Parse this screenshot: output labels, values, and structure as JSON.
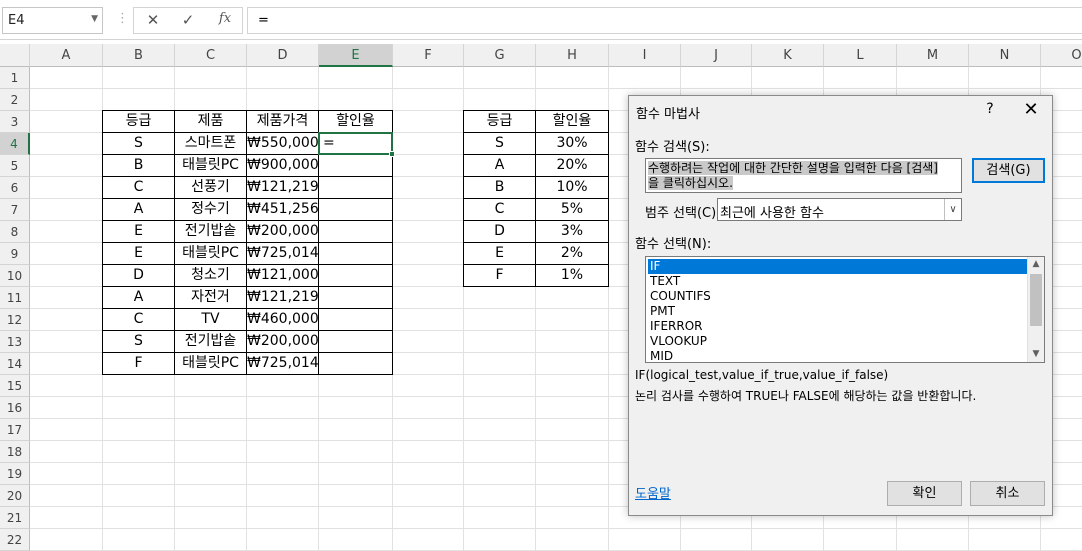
{
  "formula_bar": {
    "name_box": "E4",
    "cancel_icon": "✕",
    "enter_icon": "✓",
    "fx_icon": "fx",
    "formula": "="
  },
  "columns": [
    "A",
    "B",
    "C",
    "D",
    "E",
    "F",
    "G",
    "H",
    "I",
    "J",
    "K",
    "L",
    "M",
    "N",
    "O"
  ],
  "rows": [
    "1",
    "2",
    "3",
    "4",
    "5",
    "6",
    "7",
    "8",
    "9",
    "10",
    "11",
    "12",
    "13",
    "14",
    "15",
    "16",
    "17",
    "18",
    "19",
    "20",
    "21",
    "22"
  ],
  "table1": {
    "headers": [
      "등급",
      "제품",
      "제품가격",
      "할인율"
    ],
    "rows": [
      [
        "S",
        "스마트폰",
        "₩550,000",
        "="
      ],
      [
        "B",
        "태블릿PC",
        "₩900,000",
        ""
      ],
      [
        "C",
        "선풍기",
        "₩121,219",
        ""
      ],
      [
        "A",
        "정수기",
        "₩451,256",
        ""
      ],
      [
        "E",
        "전기밥솥",
        "₩200,000",
        ""
      ],
      [
        "E",
        "태블릿PC",
        "₩725,014",
        ""
      ],
      [
        "D",
        "청소기",
        "₩121,000",
        ""
      ],
      [
        "A",
        "자전거",
        "₩121,219",
        ""
      ],
      [
        "C",
        "TV",
        "₩460,000",
        ""
      ],
      [
        "S",
        "전기밥솥",
        "₩200,000",
        ""
      ],
      [
        "F",
        "태블릿PC",
        "₩725,014",
        ""
      ]
    ]
  },
  "table2": {
    "headers": [
      "등급",
      "할인율"
    ],
    "rows": [
      [
        "S",
        "30%"
      ],
      [
        "A",
        "20%"
      ],
      [
        "B",
        "10%"
      ],
      [
        "C",
        "5%"
      ],
      [
        "D",
        "3%"
      ],
      [
        "E",
        "2%"
      ],
      [
        "F",
        "1%"
      ]
    ]
  },
  "dialog": {
    "title": "함수 마법사",
    "help": "?",
    "close": "✕",
    "search_label": "함수 검색(S):",
    "search_text_line1": "수행하려는 작업에 대한 간단한 설명을 입력한 다음 [검색]",
    "search_text_line2": "을 클릭하십시오.",
    "search_button": "검색(G)",
    "category_label": "범주 선택(C):",
    "category_value": "최근에 사용한 함수",
    "function_label": "함수 선택(N):",
    "functions": [
      "IF",
      "TEXT",
      "COUNTIFS",
      "PMT",
      "IFERROR",
      "VLOOKUP",
      "MID"
    ],
    "syntax": "IF(logical_test,value_if_true,value_if_false)",
    "description": "논리 검사를 수행하여 TRUE나 FALSE에 해당하는 값을 반환합니다.",
    "help_link": "도움말",
    "ok": "확인",
    "cancel": "취소"
  }
}
